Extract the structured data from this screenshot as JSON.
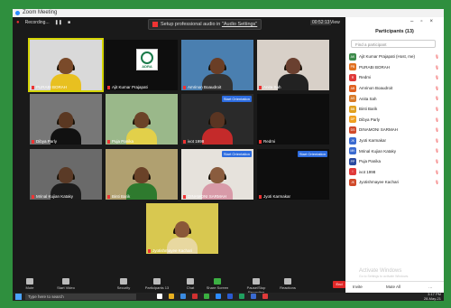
{
  "window": {
    "title": "Zoom Meeting"
  },
  "topbar": {
    "recording": "Recording...",
    "banner_text": "Setup professional audio in ",
    "banner_link": "\"Audio Settings\"",
    "timer": "00:52:13",
    "view_label": "View"
  },
  "tiles": [
    {
      "name": "PURABI BORAH",
      "active": true,
      "skin": "#7a4a2a",
      "shirt": "#e8c020",
      "bg": "#d9d9d9"
    },
    {
      "name": "Ajit Kumar Prajapati",
      "active": false,
      "logo": "ADRA"
    },
    {
      "name": "Amrinon Boaudroit",
      "active": false,
      "skin": "#6a3e26",
      "shirt": "#333",
      "bg": "#4a7fb0"
    },
    {
      "name": "Anita Sah",
      "active": false,
      "skin": "#6a4030",
      "shirt": "#222",
      "bg": "#d8d0c8"
    },
    {
      "name": "Dibya Parly",
      "active": false,
      "skin": "#5a3822",
      "shirt": "#111",
      "bg": "#777"
    },
    {
      "name": "Puja Panika",
      "active": false,
      "skin": "#6b4428",
      "shirt": "#e2d04a",
      "bg": "#9ab88a"
    },
    {
      "name": "ivot 1998",
      "active": false,
      "skin": "#5a3522",
      "shirt": "#c42a2a",
      "bg": "#2a2a2a",
      "pill": "Start Orientation"
    },
    {
      "name": "Redmi",
      "active": false,
      "empty": true
    },
    {
      "name": "Mrinal Kujian Kataky",
      "active": false,
      "skin": "#5a3a26",
      "shirt": "#1c1c1c",
      "bg": "#6a6a6a"
    },
    {
      "name": "Binti Barik",
      "active": false,
      "skin": "#6a4228",
      "shirt": "#2e7a2e",
      "bg": "#b0a070"
    },
    {
      "name": "DINAMONI SARMAH",
      "active": false,
      "skin": "#8a5c3e",
      "shirt": "#d89aa8",
      "bg": "#e6e2dc",
      "pill": "Start Orientation"
    },
    {
      "name": "Jyoti Karmakar",
      "active": false,
      "empty": true,
      "pill": "Start Orientation"
    },
    {
      "name": "Jyotishmayee Kachari",
      "active": false,
      "skin": "#8a5838",
      "shirt": "#e8d8a0",
      "bg": "#d8c850"
    }
  ],
  "toolbar": {
    "mute": "Mute",
    "video": "Start Video",
    "security": "Security",
    "participants": "Participants",
    "participants_count": "13",
    "chat": "Chat",
    "share": "Share Screen",
    "record": "Pause/Stop Recording",
    "reactions": "Reactions",
    "end": "End"
  },
  "taskbar": {
    "search_placeholder": "Type here to search",
    "time": "3:17 PM",
    "date": "28-May-21"
  },
  "panel": {
    "header": "Participants (13)",
    "find_placeholder": "Find a participant",
    "participants": [
      {
        "name": "Ajit Kumar Prajapati (Host, me)",
        "initials": "AK",
        "color": "#3c8a4a"
      },
      {
        "name": "PURABI BORAH",
        "initials": "PB",
        "color": "#e07020"
      },
      {
        "name": "Redmi",
        "initials": "R",
        "color": "#e03a3a"
      },
      {
        "name": "Amrinon Boaudroit",
        "initials": "AB",
        "color": "#e06020"
      },
      {
        "name": "Anita Sah",
        "initials": "AS",
        "color": "#d87a2a"
      },
      {
        "name": "Binti Barik",
        "initials": "BB",
        "color": "#e0a020"
      },
      {
        "name": "Dibya Parly",
        "initials": "DP",
        "color": "#f0a020"
      },
      {
        "name": "DINAMONI SARMAH",
        "initials": "DS",
        "color": "#d04a2a"
      },
      {
        "name": "Jyoti Karmakar",
        "initials": "JK",
        "color": "#3a6ad0"
      },
      {
        "name": "Mrinal Kujian Kataky",
        "initials": "MK",
        "color": "#3a6ad0"
      },
      {
        "name": "Puja Panika",
        "initials": "PP",
        "color": "#2a4aa0"
      },
      {
        "name": "ivot 1998",
        "initials": "I",
        "color": "#e03a3a"
      },
      {
        "name": "Jyotishmayee Kachari",
        "initials": "JK",
        "color": "#d04a2a"
      }
    ],
    "activate": "Activate Windows",
    "activate_sub": "Go to Settings to activate Windows.",
    "invite": "Invite",
    "mute_all": "Mute All"
  },
  "colors": {
    "frame": "#2f8f3e",
    "end": "#e02828",
    "zoom_blue": "#2d8cff"
  }
}
